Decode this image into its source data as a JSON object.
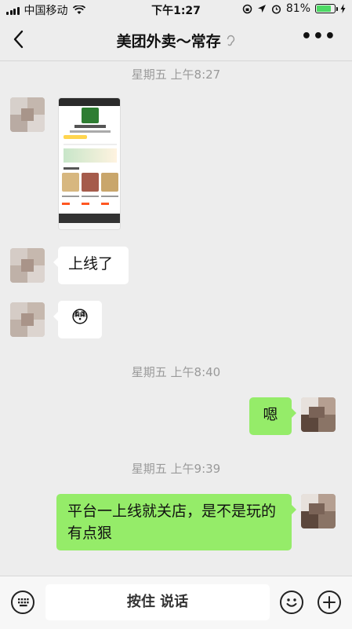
{
  "status_bar": {
    "carrier": "中国移动",
    "time": "下午1:27",
    "battery_percent": "81%",
    "battery_level": 0.81,
    "colors": {
      "battery": "#4cd964"
    }
  },
  "header": {
    "title": "美团外卖～常存",
    "back_icon": "chevron-left-icon",
    "mute_icon": "ear-icon",
    "more_icon": "more-dots-icon"
  },
  "timestamps": [
    "星期五 上午8:27",
    "星期五 上午8:40",
    "星期五 上午9:39"
  ],
  "messages": [
    {
      "sender": "other",
      "type": "image"
    },
    {
      "sender": "other",
      "type": "text",
      "text": "上线了"
    },
    {
      "sender": "other",
      "type": "emoji",
      "text": "😳"
    },
    {
      "sender": "me",
      "type": "text",
      "text": "嗯"
    },
    {
      "sender": "me",
      "type": "text",
      "text": "平台一上线就关店，是不是玩的有点狠"
    }
  ],
  "input_bar": {
    "voice_icon": "keyboard-icon",
    "hold_to_talk": "按住 说话",
    "emoji_icon": "smiley-icon",
    "plus_icon": "plus-circle-icon"
  },
  "colors": {
    "chat_bg": "#ededed",
    "outgoing_bubble": "#95ec69",
    "incoming_bubble": "#ffffff"
  }
}
